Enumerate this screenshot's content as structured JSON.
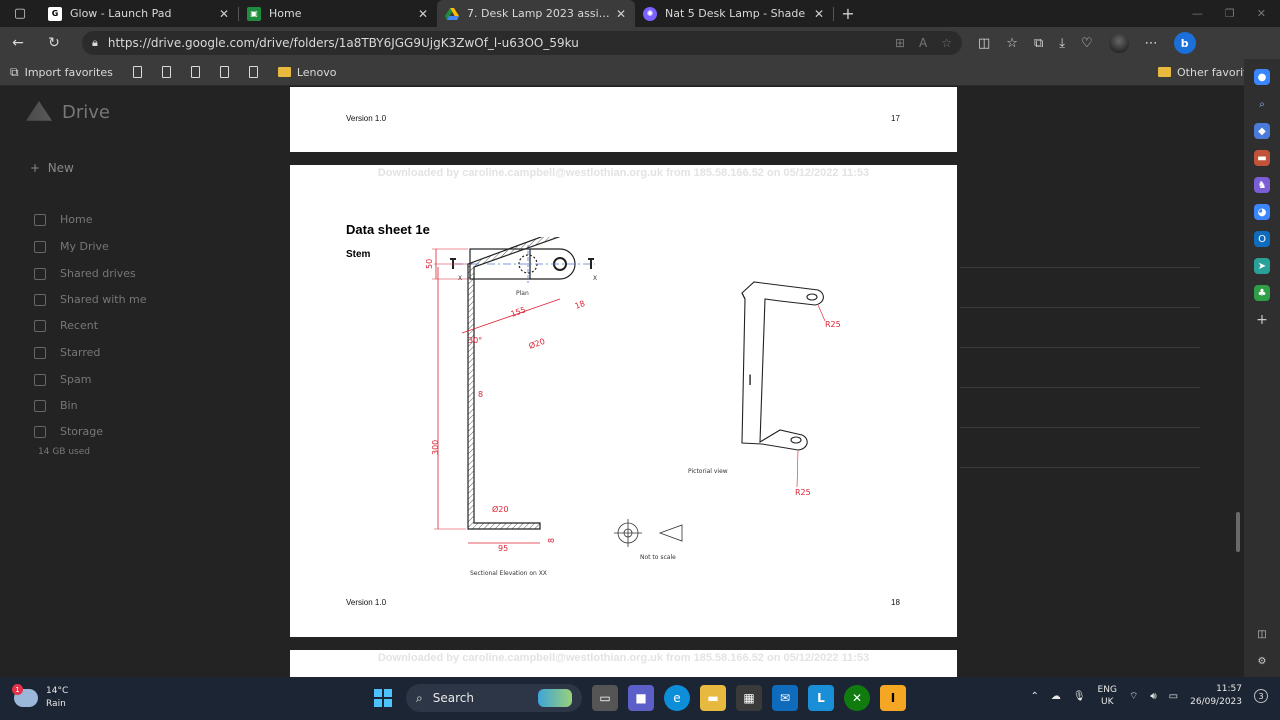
{
  "tabs": [
    {
      "title": "Glow - Launch Pad",
      "favicon": "glow-icon",
      "color": "#ffffff"
    },
    {
      "title": "Home",
      "favicon": "classroom-icon",
      "color": "#1e8e3e"
    },
    {
      "title": "7. Desk Lamp 2023 assignment -",
      "favicon": "drive-icon",
      "color": "#fbbc04",
      "active": true
    },
    {
      "title": "Nat 5 Desk Lamp - Shade",
      "favicon": "app-icon",
      "color": "#7b61ff"
    }
  ],
  "address": {
    "url": "https://drive.google.com/drive/folders/1a8TBY6JGG9UjgK3ZwOf_l-u63OO_59ku"
  },
  "favorites": {
    "import": "Import favorites",
    "lenovo": "Lenovo",
    "other": "Other favorites"
  },
  "drive": {
    "logo": "Drive",
    "new": "New",
    "nav": [
      "Home",
      "My Drive",
      "Shared drives",
      "Shared with me",
      "Recent",
      "Starred",
      "Spam",
      "Bin",
      "Storage"
    ],
    "storage_used": "14 GB used"
  },
  "pdf": {
    "page17": {
      "version": "Version 1.0",
      "number": "17"
    },
    "page18": {
      "watermark": "Downloaded by caroline.campbell@westlothian.org.uk from 185.58.166.52 on 05/12/2022 11:53",
      "title": "Data sheet 1e",
      "subtitle": "Stem",
      "version": "Version 1.0",
      "number": "18",
      "labels": {
        "plan": "Plan",
        "sectional": "Sectional Elevation on XX",
        "pictorial": "Pictorial view",
        "not_to_scale": "Not to scale",
        "dim_50": "50",
        "dim_155": "155",
        "dim_18": "18",
        "dim_30": "30°",
        "dim_d20a": "Ø20",
        "dim_8a": "8",
        "dim_300": "300",
        "dim_d20b": "Ø20",
        "dim_95": "95",
        "dim_8b": "8",
        "r25a": "R25",
        "r25b": "R25",
        "x1": "X",
        "x2": "X"
      }
    },
    "page19": {
      "watermark": "Downloaded by caroline.campbell@westlothian.org.uk from 185.58.166.52 on 05/12/2022 11:53"
    }
  },
  "taskbar": {
    "temp": "14°C",
    "condition": "Rain",
    "weather_badge": "1",
    "search": "Search",
    "lang1": "ENG",
    "lang2": "UK",
    "time": "11:57",
    "date": "26/09/2023",
    "notif_count": "3"
  }
}
